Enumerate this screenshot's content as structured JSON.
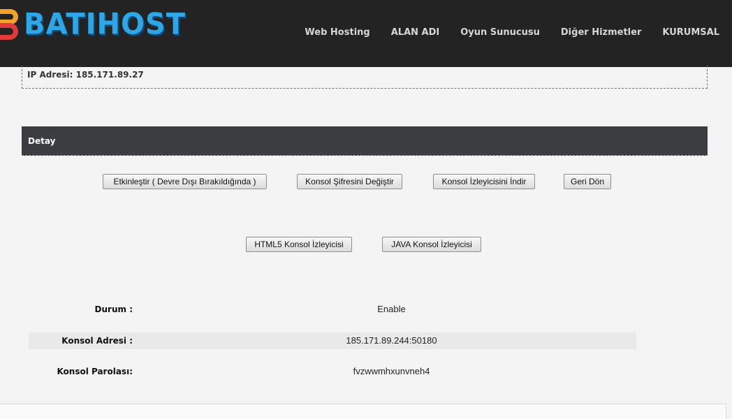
{
  "header": {
    "logo_text": "BATIHOST",
    "nav": [
      {
        "label": "Web Hosting"
      },
      {
        "label": "ALAN ADI"
      },
      {
        "label": "Oyun Sunucusu"
      },
      {
        "label": "Diğer Hizmetler"
      },
      {
        "label": "KURUMSAL"
      }
    ]
  },
  "ip_info": {
    "text": "IP Adresi: 185.171.89.27"
  },
  "detail_section": {
    "title": "Detay"
  },
  "actions": {
    "enable": "Etkinleştir ( Devre Dışı Bırakıldığında )",
    "change_password": "Konsol Şifresini Değiştir",
    "download_viewer": "Konsol İzleyicisini İndir",
    "back": "Geri Dön",
    "html5_viewer": "HTML5 Konsol İzleyicisi",
    "java_viewer": "JAVA Konsol İzleyicisi"
  },
  "details": [
    {
      "label": "Durum :",
      "value": "Enable"
    },
    {
      "label": "Konsol Adresi :",
      "value": "185.171.89.244:50180"
    },
    {
      "label": "Konsol Parolası:",
      "value": "fvzwwmhxunvneh4"
    }
  ],
  "colors": {
    "header_bg": "#232323",
    "section_bar": "#3c3d41",
    "logo_blue": "#2fa7e6",
    "logo_orange": "#f2a22a",
    "logo_red": "#e23a3a"
  }
}
